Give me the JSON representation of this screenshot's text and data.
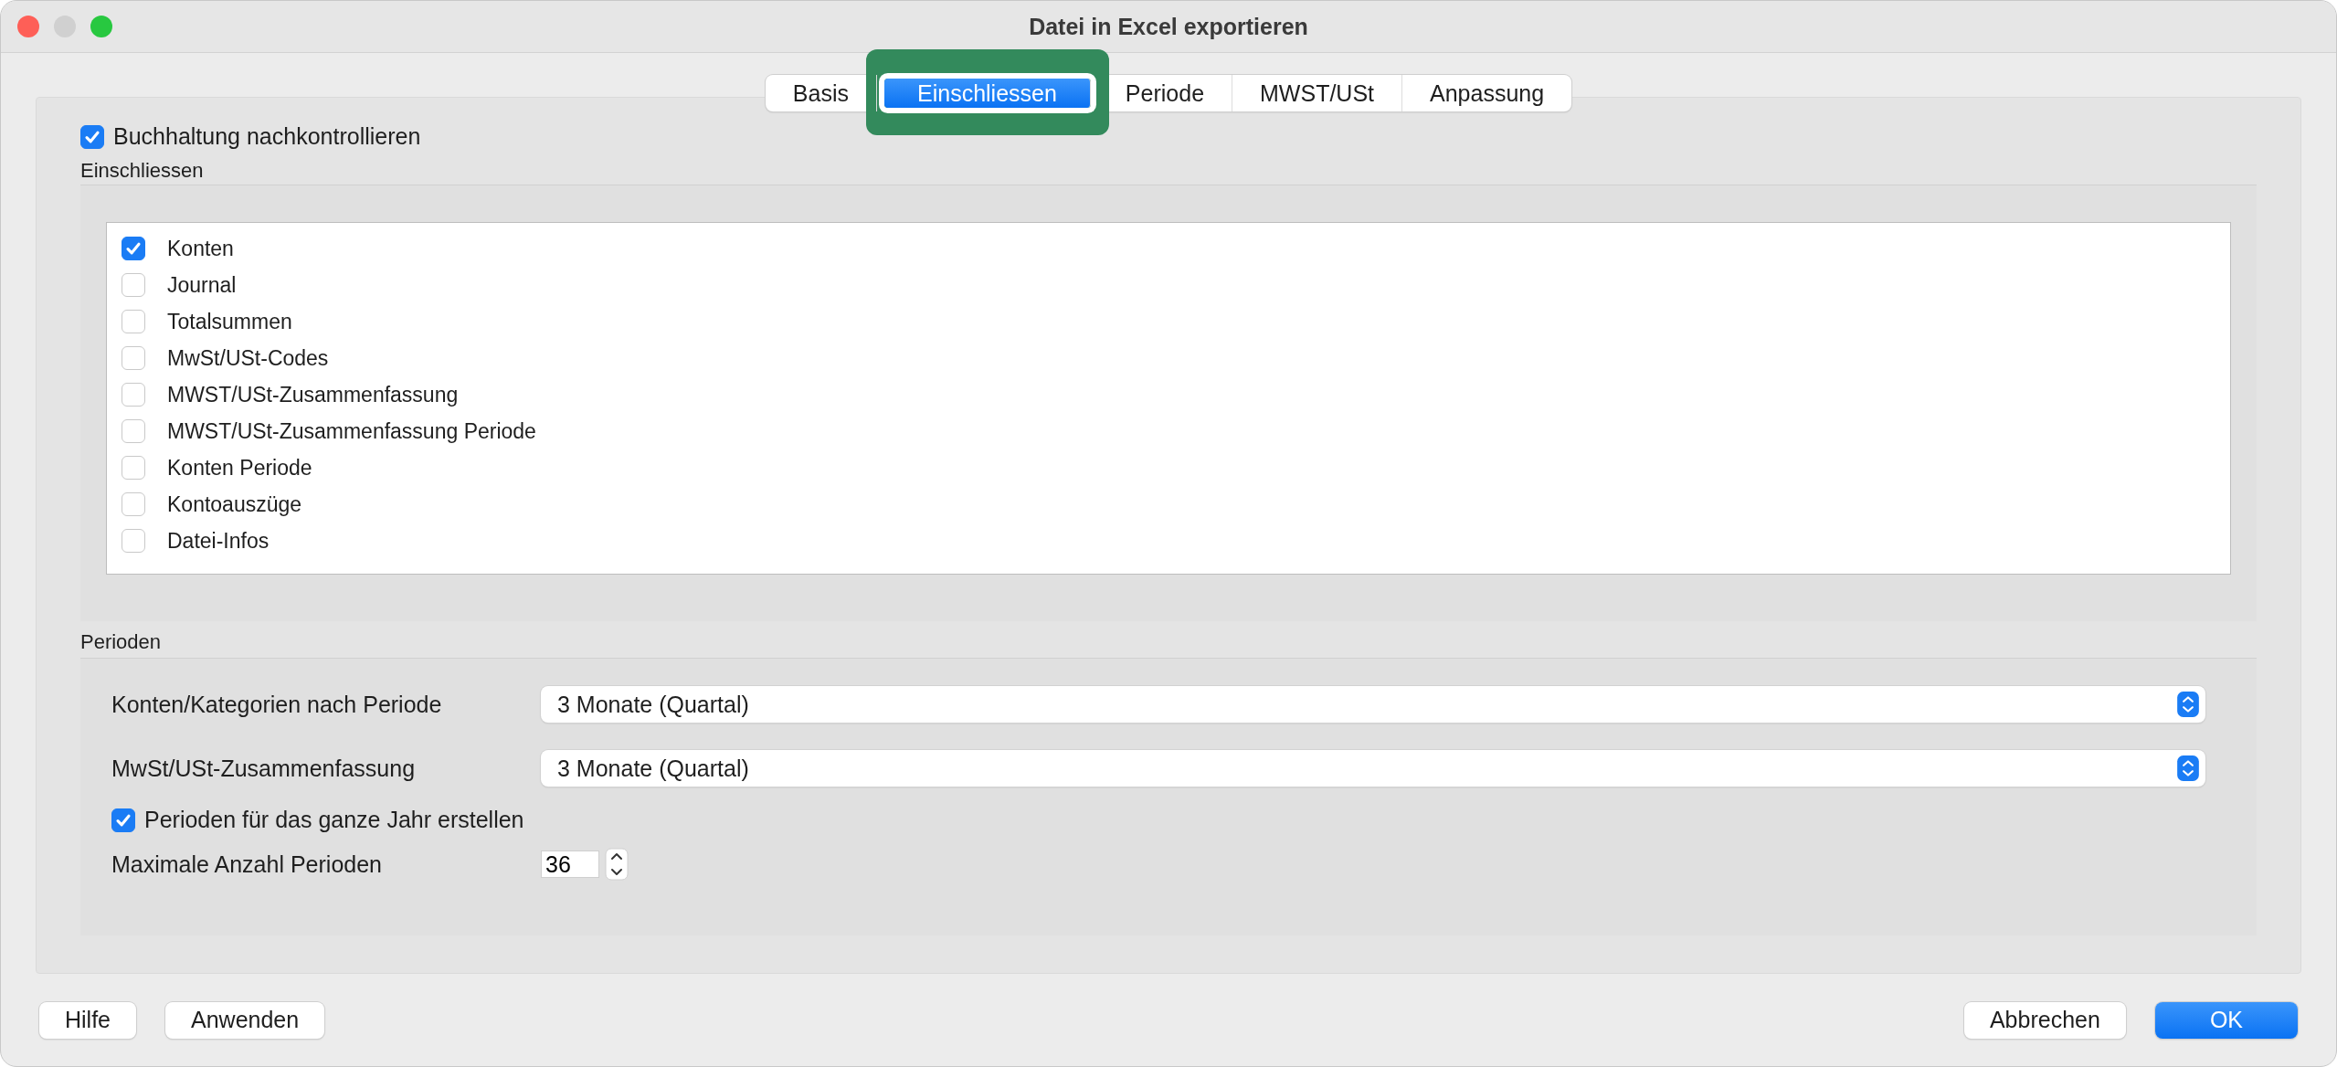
{
  "window": {
    "title": "Datei in Excel exportieren"
  },
  "tabs": [
    {
      "label": "Basis",
      "selected": false,
      "highlighted": false
    },
    {
      "label": "Einschliessen",
      "selected": true,
      "highlighted": true
    },
    {
      "label": "Periode",
      "selected": false,
      "highlighted": false
    },
    {
      "label": "MWST/USt",
      "selected": false,
      "highlighted": false
    },
    {
      "label": "Anpassung",
      "selected": false,
      "highlighted": false
    }
  ],
  "review": {
    "label": "Buchhaltung nachkontrollieren",
    "checked": true
  },
  "include": {
    "title": "Einschliessen",
    "items": [
      {
        "label": "Konten",
        "checked": true
      },
      {
        "label": "Journal",
        "checked": false
      },
      {
        "label": "Totalsummen",
        "checked": false
      },
      {
        "label": "MwSt/USt-Codes",
        "checked": false
      },
      {
        "label": "MWST/USt-Zusammenfassung",
        "checked": false
      },
      {
        "label": "MWST/USt-Zusammenfassung Periode",
        "checked": false
      },
      {
        "label": "Konten Periode",
        "checked": false
      },
      {
        "label": "Kontoauszüge",
        "checked": false
      },
      {
        "label": "Datei-Infos",
        "checked": false
      }
    ]
  },
  "periods": {
    "title": "Perioden",
    "popups": [
      {
        "label": "Konten/Kategorien nach Periode",
        "value": "3 Monate (Quartal)"
      },
      {
        "label": "MwSt/USt-Zusammenfassung",
        "value": "3 Monate (Quartal)"
      }
    ],
    "whole_year": {
      "label": "Perioden für das ganze Jahr erstellen",
      "checked": true
    },
    "max": {
      "label": "Maximale Anzahl Perioden",
      "value": "36"
    }
  },
  "buttons_left": [
    "Hilfe",
    "Anwenden"
  ],
  "buttons_right": [
    {
      "label": "Abbrechen",
      "default": false
    },
    {
      "label": "OK",
      "default": true
    }
  ]
}
